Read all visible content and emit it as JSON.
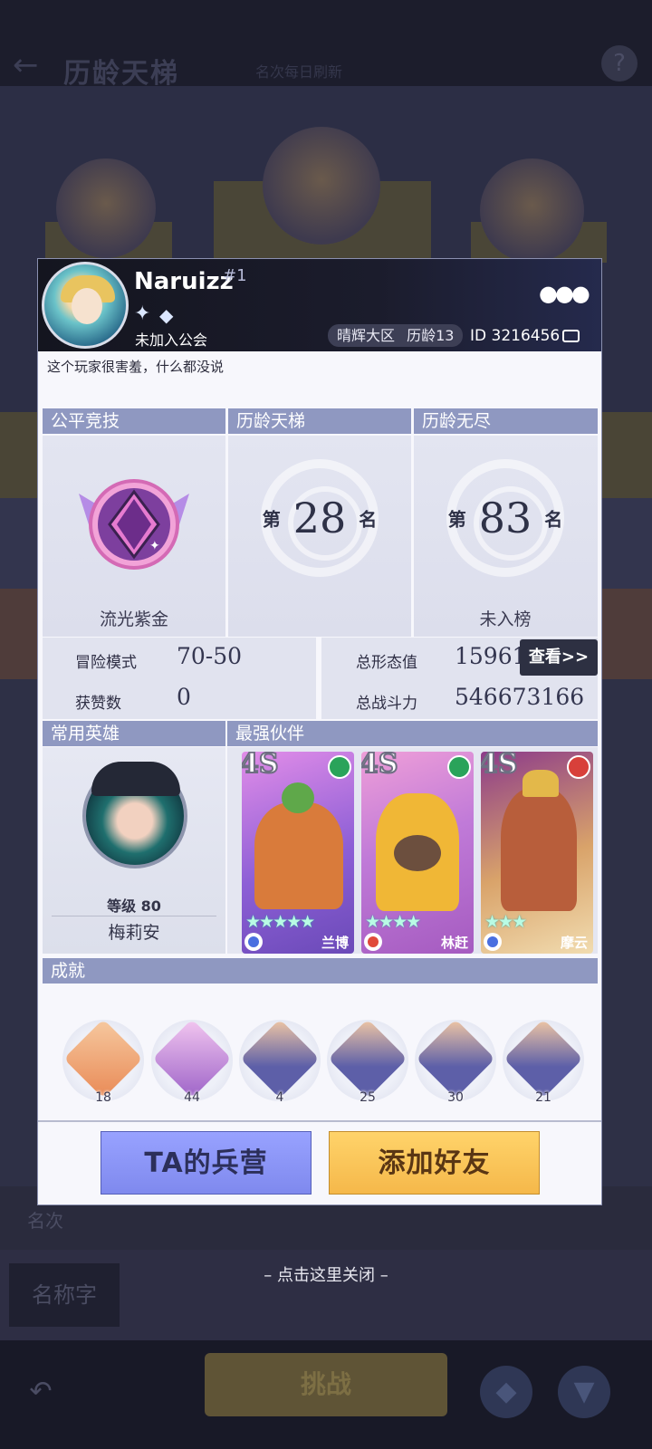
{
  "background": {
    "title": "历龄天梯",
    "subtitle": "名次每日刷新",
    "rank_row_text": "名次",
    "tag_text": "名称字",
    "bottom_button": "挑战",
    "help": "?"
  },
  "profile": {
    "name": "Naruizz",
    "rank_tag": "#1",
    "guild": "未加入公会",
    "region": "晴辉大区",
    "age": "历龄13",
    "id_text": "ID 3216456",
    "signature": "这个玩家很害羞，什么都没说"
  },
  "ranking": {
    "fair": {
      "header": "公平竞技",
      "tier": "流光紫金"
    },
    "ladder": {
      "header": "历龄天梯",
      "prefix": "第",
      "rank": "28",
      "suffix": "名"
    },
    "endless": {
      "header": "历龄无尽",
      "prefix": "第",
      "rank": "83",
      "suffix": "名",
      "status": "未入榜"
    }
  },
  "stats": {
    "adventure_label": "冒险模式",
    "adventure_value": "70-50",
    "likes_label": "获赞数",
    "likes_value": "0",
    "form_label": "总形态值",
    "form_value": "15961",
    "power_label": "总战斗力",
    "power_value": "546673166",
    "view_button": "查看>>"
  },
  "hero": {
    "header": "常用英雄",
    "level": "等级 80",
    "name": "梅莉安"
  },
  "partners": {
    "header": "最强伙伴",
    "cards": [
      {
        "grade": "4S",
        "name": "兰博",
        "stars": 5,
        "element_color": "#2aa35a",
        "class_color": "#4a6fe0"
      },
      {
        "grade": "4S",
        "name": "林赶",
        "stars": 4,
        "element_color": "#2aa35a",
        "class_color": "#e04a3a"
      },
      {
        "grade": "4S",
        "name": "摩云",
        "stars": 3,
        "element_color": "#d8403a",
        "class_color": "#4a6fe0"
      }
    ]
  },
  "achievements": {
    "header": "成就",
    "counts": [
      "18",
      "44",
      "4",
      "25",
      "30",
      "21"
    ]
  },
  "buttons": {
    "barracks": "TA的兵营",
    "add_friend": "添加好友"
  },
  "close_hint": "– 点击这里关闭 –"
}
